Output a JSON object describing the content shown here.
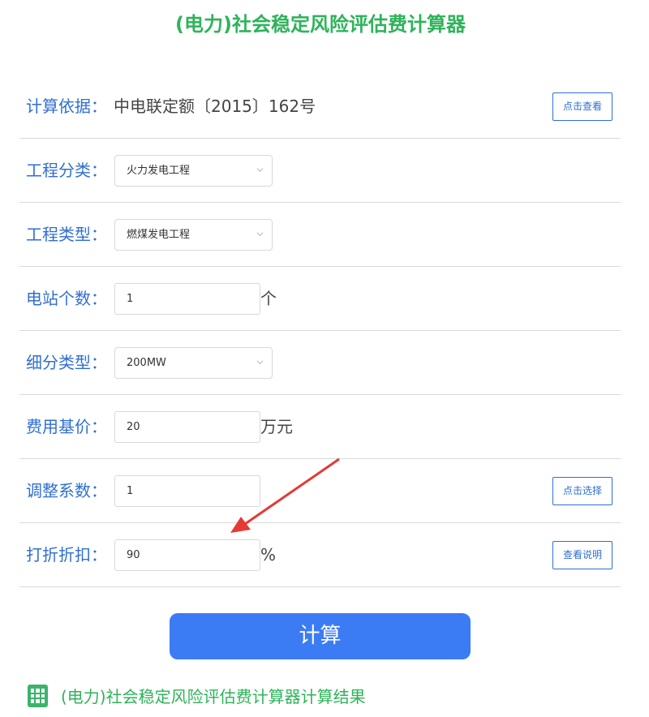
{
  "title": "(电力)社会稳定风险评估费计算器",
  "basis": {
    "label": "计算依据：",
    "value": "中电联定额〔2015〕162号",
    "button": "点击查看"
  },
  "project_category": {
    "label": "工程分类：",
    "selected": "火力发电工程"
  },
  "project_type": {
    "label": "工程类型：",
    "selected": "燃煤发电工程"
  },
  "station_count": {
    "label": "电站个数：",
    "value": "1",
    "unit": "个"
  },
  "sub_type": {
    "label": "细分类型：",
    "selected": "200MW"
  },
  "base_price": {
    "label": "费用基价：",
    "value": "20",
    "unit": "万元"
  },
  "adjust_factor": {
    "label": "调整系数：",
    "value": "1",
    "button": "点击选择"
  },
  "discount": {
    "label": "打折折扣：",
    "value": "90",
    "unit": "%",
    "button": "查看说明"
  },
  "calculate_button": "计算",
  "result": {
    "title": "(电力)社会稳定风险评估费计算器计算结果"
  },
  "colors": {
    "title_green": "#2eb35a",
    "label_blue": "#2f6fd1",
    "button_blue": "#3b7cf5",
    "arrow_red": "#e53935"
  }
}
